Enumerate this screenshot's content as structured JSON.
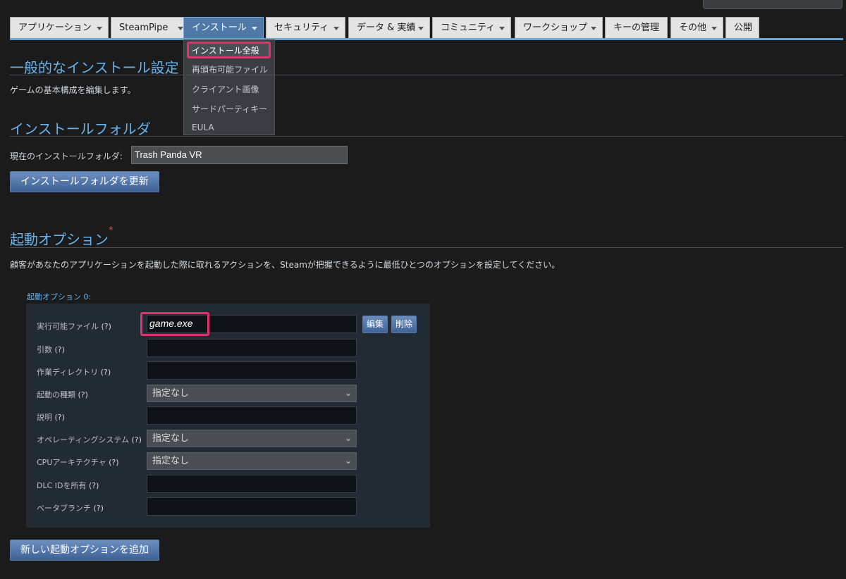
{
  "nav": {
    "tabs": [
      {
        "label": "アプリケーション",
        "has_menu": true
      },
      {
        "label": "SteamPipe",
        "has_menu": true
      },
      {
        "label": "インストール",
        "has_menu": true,
        "active": true
      },
      {
        "label": "セキュリティ",
        "has_menu": true
      },
      {
        "label": "データ & 実績",
        "has_menu": true
      },
      {
        "label": "コミュニティ",
        "has_menu": true
      },
      {
        "label": "ワークショップ",
        "has_menu": true
      },
      {
        "label": "キーの管理",
        "has_menu": false
      },
      {
        "label": "その他",
        "has_menu": true
      },
      {
        "label": "公開",
        "has_menu": false
      }
    ],
    "dropdown": {
      "items": [
        "インストール全般",
        "再頒布可能ファイル",
        "クライアント画像",
        "サードパーティキー",
        "EULA"
      ],
      "highlighted": "インストール全般"
    }
  },
  "general": {
    "title": "一般的なインストール設定",
    "description": "ゲームの基本構成を編集します。"
  },
  "folder": {
    "title": "インストールフォルダ",
    "current_label": "現在のインストールフォルダ:",
    "current_value": "Trash Panda VR",
    "update_button": "インストールフォルダを更新"
  },
  "launch": {
    "title": "起動オプション",
    "required_mark": "*",
    "description": "顧客があなたのアプリケーションを起動した際に取れるアクションを、Steamが把握できるように最低ひとつのオプションを設定してください。",
    "option_label": "起動オプション 0:",
    "rows": [
      {
        "label": "実行可能ファイル",
        "help": "(?)",
        "value": "game.exe"
      },
      {
        "label": "引数",
        "help": "(?)",
        "value": ""
      },
      {
        "label": "作業ディレクトリ",
        "help": "(?)",
        "value": ""
      },
      {
        "label": "起動の種類",
        "help": "(?)",
        "value": "指定なし"
      },
      {
        "label": "説明",
        "help": "(?)",
        "value": ""
      },
      {
        "label": "オペレーティングシステム",
        "help": "(?)",
        "value": "指定なし"
      },
      {
        "label": "CPUアーキテクチャ",
        "help": "(?)",
        "value": "指定なし"
      },
      {
        "label": "DLC IDを所有",
        "help": "(?)",
        "value": ""
      },
      {
        "label": "ベータブランチ",
        "help": "(?)",
        "value": ""
      }
    ],
    "edit_button": "編集",
    "delete_button": "削除",
    "add_button": "新しい起動オプションを追加"
  },
  "colors": {
    "accent_blue": "#66b3ee",
    "active_tab": "#4f79a7",
    "highlight": "#e0336b",
    "background": "#1b1b1c"
  }
}
